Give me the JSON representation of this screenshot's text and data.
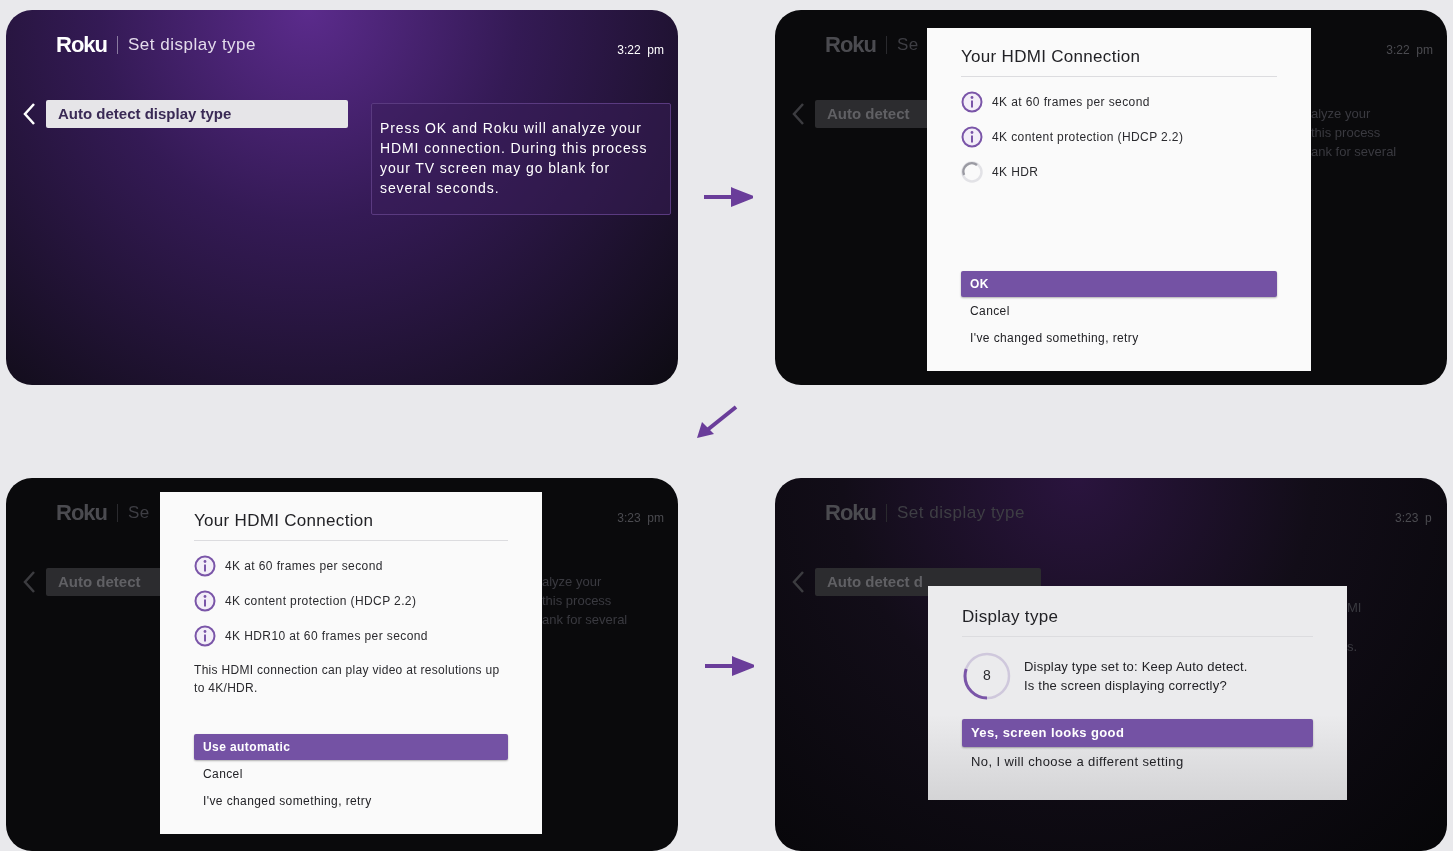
{
  "screens": [
    {
      "kind": "menu",
      "logo": "Roku",
      "title": "Set display type",
      "time": "3:22  pm",
      "menu_item": {
        "label": "Auto detect display type",
        "selected": true
      },
      "info_text": "Press OK and Roku will analyze your HDMI connection. During this process your TV screen may go blank for several seconds."
    },
    {
      "kind": "dialog",
      "logo": "Roku",
      "title": "Se",
      "time": "3:22  pm",
      "menu_item": {
        "label": "Auto detect",
        "selected": true
      },
      "info_fragments": [
        "alyze your",
        "this process",
        "ank for several"
      ],
      "dialog": {
        "title": "Your HDMI Connection",
        "checks": [
          {
            "label": "4K at 60 frames per second",
            "kind": "done"
          },
          {
            "label": "4K content protection (HDCP 2.2)",
            "kind": "done"
          },
          {
            "label": "4K HDR",
            "kind": "checking"
          }
        ],
        "options": [
          {
            "label": "OK",
            "selected": true
          },
          {
            "label": "Cancel",
            "selected": false
          },
          {
            "label": "I've changed something, retry",
            "selected": false
          }
        ]
      }
    },
    {
      "kind": "dialog",
      "logo": "Roku",
      "title": "Se",
      "time": "3:23  pm",
      "menu_item": {
        "label": "Auto detect",
        "selected": true
      },
      "info_fragments": [
        "alyze your",
        "this process",
        "ank for several"
      ],
      "dialog": {
        "title": "Your HDMI Connection",
        "checks": [
          {
            "label": "4K at 60 frames per second",
            "kind": "done"
          },
          {
            "label": "4K content protection (HDCP 2.2)",
            "kind": "done"
          },
          {
            "label": "4K HDR10 at 60 frames per second",
            "kind": "done"
          }
        ],
        "message": "This HDMI connection can play video at resolutions up to 4K/HDR.",
        "options": [
          {
            "label": "Use automatic",
            "selected": true
          },
          {
            "label": "Cancel",
            "selected": false
          },
          {
            "label": "I've changed something, retry",
            "selected": false
          }
        ]
      }
    },
    {
      "kind": "confirm",
      "logo": "Roku",
      "title": "Set display type",
      "time": "3:23  p",
      "menu_item": {
        "label": "Auto detect d",
        "selected": true
      },
      "info_fragments": [
        "MI",
        "s."
      ],
      "dialog": {
        "title": "Display type",
        "countdown": {
          "value": "8",
          "level": 0.3
        },
        "message_lines": [
          "Display type set to: Keep Auto detect.",
          "Is the screen displaying correctly?"
        ],
        "options": [
          {
            "label": "Yes, screen looks good",
            "selected": true
          },
          {
            "label": "No, I will choose a different setting",
            "selected": false
          }
        ]
      }
    }
  ],
  "arrows": [
    {
      "kind": "right"
    },
    {
      "kind": "down-left"
    },
    {
      "kind": "right"
    }
  ]
}
